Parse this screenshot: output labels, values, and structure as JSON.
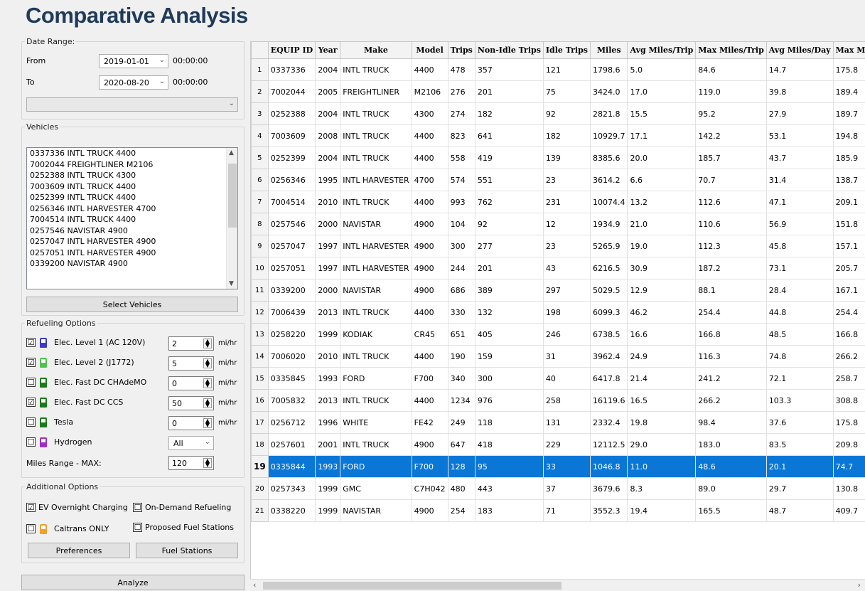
{
  "title": "Comparative Analysis",
  "date_range": {
    "legend": "Date Range:",
    "from_label": "From",
    "from_date": "2019-01-01",
    "from_time": "00:00:00",
    "to_label": "To",
    "to_date": "2020-08-20",
    "to_time": "00:00:00"
  },
  "vehicles": {
    "legend": "Vehicles",
    "items": [
      "0337336 INTL TRUCK 4400",
      "7002044 FREIGHTLINER M2106",
      "0252388 INTL TRUCK 4300",
      "7003609 INTL TRUCK 4400",
      "0252399 INTL TRUCK 4400",
      "0256346 INTL HARVESTER 4700",
      "7004514 INTL TRUCK 4400",
      "0257546 NAVISTAR 4900",
      "0257047 INTL HARVESTER 4900",
      "0257051 INTL HARVESTER 4900",
      "0339200 NAVISTAR 4900"
    ],
    "select_button": "Select Vehicles"
  },
  "refueling": {
    "legend": "Refueling Options",
    "options": [
      {
        "label": "Elec. Level 1 (AC 120V)",
        "checked": "☑",
        "value": "2",
        "unit": "mi/hr",
        "color": "#3a3ad0"
      },
      {
        "label": "Elec. Level 2 (J1772)",
        "checked": "☑",
        "value": "5",
        "unit": "mi/hr",
        "color": "#4fc24f"
      },
      {
        "label": "Elec. Fast DC CHAdeMO",
        "checked": "☐",
        "value": "0",
        "unit": "mi/hr",
        "color": "#1a7a1a"
      },
      {
        "label": "Elec. Fast DC CCS",
        "checked": "☑",
        "value": "50",
        "unit": "mi/hr",
        "color": "#1a7a1a"
      },
      {
        "label": "Tesla",
        "checked": "☐",
        "value": "0",
        "unit": "mi/hr",
        "color": "#1a7a1a"
      },
      {
        "label": "Hydrogen",
        "checked": "☐",
        "value": "All",
        "unit": "",
        "color": "#9b2fc9"
      }
    ],
    "miles_range_label": "Miles Range - MAX:",
    "miles_range_value": "120"
  },
  "additional": {
    "legend": "Additional Options",
    "ev_overnight": "EV Overnight Charging",
    "ev_overnight_checked": "☑",
    "on_demand": "On-Demand Refueling",
    "on_demand_checked": "☐",
    "caltrans": "Caltrans ONLY",
    "caltrans_checked": "☐",
    "caltrans_color": "#f0a030",
    "proposed": "Proposed Fuel Stations",
    "proposed_checked": "☐",
    "preferences_button": "Preferences",
    "fuel_stations_button": "Fuel Stations"
  },
  "analyze_button": "Analyze",
  "table": {
    "columns": [
      "EQUIP ID",
      "Year",
      "Make",
      "Model",
      "Trips",
      "Non-Idle Trips",
      "Idle Trips",
      "Miles",
      "Avg Miles/Trip",
      "Max Miles/Trip",
      "Avg Miles/Day",
      "Max Mi"
    ],
    "selected_row": 19,
    "rows": [
      [
        "1",
        "0337336",
        "2004",
        "INTL TRUCK",
        "4400",
        "478",
        "357",
        "121",
        "1798.6",
        "5.0",
        "84.6",
        "14.7",
        "175.8"
      ],
      [
        "2",
        "7002044",
        "2005",
        "FREIGHTLINER",
        "M2106",
        "276",
        "201",
        "75",
        "3424.0",
        "17.0",
        "119.0",
        "39.8",
        "189.4"
      ],
      [
        "3",
        "0252388",
        "2004",
        "INTL TRUCK",
        "4300",
        "274",
        "182",
        "92",
        "2821.8",
        "15.5",
        "95.2",
        "27.9",
        "189.7"
      ],
      [
        "4",
        "7003609",
        "2008",
        "INTL TRUCK",
        "4400",
        "823",
        "641",
        "182",
        "10929.7",
        "17.1",
        "142.2",
        "53.1",
        "194.8"
      ],
      [
        "5",
        "0252399",
        "2004",
        "INTL TRUCK",
        "4400",
        "558",
        "419",
        "139",
        "8385.6",
        "20.0",
        "185.7",
        "43.7",
        "185.9"
      ],
      [
        "6",
        "0256346",
        "1995",
        "INTL HARVESTER",
        "4700",
        "574",
        "551",
        "23",
        "3614.2",
        "6.6",
        "70.7",
        "31.4",
        "138.7"
      ],
      [
        "7",
        "7004514",
        "2010",
        "INTL TRUCK",
        "4400",
        "993",
        "762",
        "231",
        "10074.4",
        "13.2",
        "112.6",
        "47.1",
        "209.1"
      ],
      [
        "8",
        "0257546",
        "2000",
        "NAVISTAR",
        "4900",
        "104",
        "92",
        "12",
        "1934.9",
        "21.0",
        "110.6",
        "56.9",
        "151.8"
      ],
      [
        "9",
        "0257047",
        "1997",
        "INTL HARVESTER",
        "4900",
        "300",
        "277",
        "23",
        "5265.9",
        "19.0",
        "112.3",
        "45.8",
        "157.1"
      ],
      [
        "10",
        "0257051",
        "1997",
        "INTL HARVESTER",
        "4900",
        "244",
        "201",
        "43",
        "6216.5",
        "30.9",
        "187.2",
        "73.1",
        "205.7"
      ],
      [
        "11",
        "0339200",
        "2000",
        "NAVISTAR",
        "4900",
        "686",
        "389",
        "297",
        "5029.5",
        "12.9",
        "88.1",
        "28.4",
        "167.1"
      ],
      [
        "12",
        "7006439",
        "2013",
        "INTL TRUCK",
        "4400",
        "330",
        "132",
        "198",
        "6099.3",
        "46.2",
        "254.4",
        "44.8",
        "254.4"
      ],
      [
        "13",
        "0258220",
        "1999",
        "KODIAK",
        "CR45",
        "651",
        "405",
        "246",
        "6738.5",
        "16.6",
        "166.8",
        "48.5",
        "166.8"
      ],
      [
        "14",
        "7006020",
        "2010",
        "INTL TRUCK",
        "4400",
        "190",
        "159",
        "31",
        "3962.4",
        "24.9",
        "116.3",
        "74.8",
        "266.2"
      ],
      [
        "15",
        "0335845",
        "1993",
        "FORD",
        "F700",
        "340",
        "300",
        "40",
        "6417.8",
        "21.4",
        "241.2",
        "72.1",
        "258.7"
      ],
      [
        "16",
        "7005832",
        "2013",
        "INTL TRUCK",
        "4400",
        "1234",
        "976",
        "258",
        "16119.6",
        "16.5",
        "266.2",
        "103.3",
        "308.8"
      ],
      [
        "17",
        "0256712",
        "1996",
        "WHITE",
        "FE42",
        "249",
        "118",
        "131",
        "2332.4",
        "19.8",
        "98.4",
        "37.6",
        "175.8"
      ],
      [
        "18",
        "0257601",
        "2001",
        "INTL TRUCK",
        "4900",
        "647",
        "418",
        "229",
        "12112.5",
        "29.0",
        "183.0",
        "83.5",
        "209.8"
      ],
      [
        "19",
        "0335844",
        "1993",
        "FORD",
        "F700",
        "128",
        "95",
        "33",
        "1046.8",
        "11.0",
        "48.6",
        "20.1",
        "74.7"
      ],
      [
        "20",
        "0257343",
        "1999",
        "GMC",
        "C7H042",
        "480",
        "443",
        "37",
        "3679.6",
        "8.3",
        "89.0",
        "29.7",
        "130.8"
      ],
      [
        "21",
        "0338220",
        "1999",
        "NAVISTAR",
        "4900",
        "254",
        "183",
        "71",
        "3552.3",
        "19.4",
        "165.5",
        "48.7",
        "409.7"
      ]
    ]
  }
}
